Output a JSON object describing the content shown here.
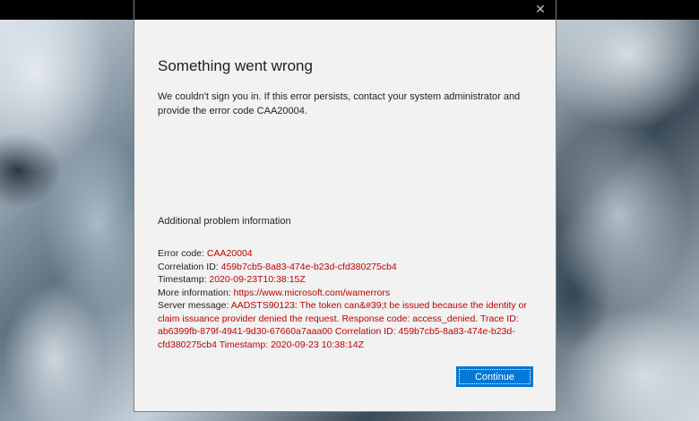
{
  "dialog": {
    "close_glyph": "✕",
    "title": "Something went wrong",
    "message": "We couldn't sign you in. If this error persists, contact your system administrator and provide the error code CAA20004.",
    "additional_header": "Additional problem information",
    "details": {
      "error_code_label": "Error code: ",
      "error_code": "CAA20004",
      "correlation_label": "Correlation ID: ",
      "correlation_id": "459b7cb5-8a83-474e-b23d-cfd380275cb4",
      "timestamp_label": "Timestamp: ",
      "timestamp": "2020-09-23T10:38:15Z",
      "more_info_label": "More information: ",
      "more_info_url": "https://www.microsoft.com/wamerrors",
      "server_message_label": "Server message: ",
      "server_message": "AADSTS90123: The token can&#39;t be issued because the identity or claim issuance provider denied the request. Response code: access_denied. Trace ID: ab6399fb-879f-4941-9d30-67660a7aaa00 Correlation ID: 459b7cb5-8a83-474e-b23d-cfd380275cb4 Timestamp: 2020-09-23 10:38:14Z"
    },
    "continue_label": "Continue"
  },
  "colors": {
    "accent": "#0078d7",
    "error_value": "#c00000",
    "dialog_bg": "#f2f2f2"
  }
}
